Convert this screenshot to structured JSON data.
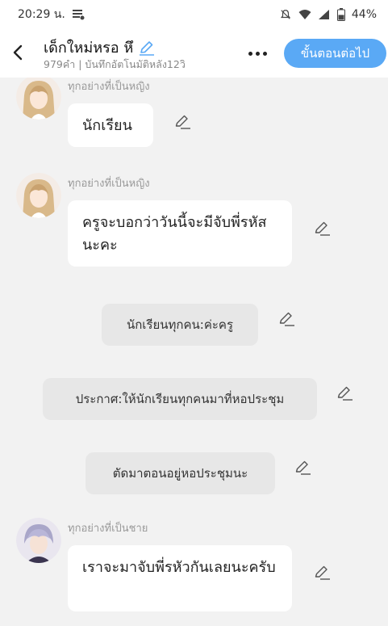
{
  "status_bar": {
    "time": "20:29 น.",
    "battery": "44%"
  },
  "header": {
    "title": "เด็กใหม่หรอ หึ",
    "subtitle": "979คำ | บันทึกอัตโนมัติหลัง12วิ",
    "next_label": "ขั้นตอนต่อไป"
  },
  "messages": [
    {
      "speaker": "ทุกอย่างที่เป็นหญิง",
      "text": "นักเรียน"
    },
    {
      "speaker": "ทุกอย่างที่เป็นหญิง",
      "text": "ครูจะบอกว่าวันนี้จะมีจับพี่รหัสนะคะ"
    },
    {
      "text": "นักเรียนทุกคน:ค่ะครู"
    },
    {
      "text": "ประกาศ:ให้นักเรียนทุกคนมาที่หอประชุม"
    },
    {
      "text": "ตัดมาตอนอยู่หอประชุมนะ"
    },
    {
      "speaker": "ทุกอย่างที่เป็นชาย",
      "text": "เราจะมาจับพี่รหัวกันเลยนะครับ"
    }
  ],
  "icons": {
    "back": "chevron-left-icon",
    "edit": "pencil-icon",
    "more": "more-horizontal-icon",
    "notifications_off": "bell-off-icon",
    "wifi": "wifi-icon",
    "signal": "signal-icon",
    "battery": "battery-icon"
  },
  "colors": {
    "accent": "#5aa9f5",
    "background": "#f2f2f2",
    "bubble": "#ffffff",
    "narration": "#e7e7e7"
  }
}
